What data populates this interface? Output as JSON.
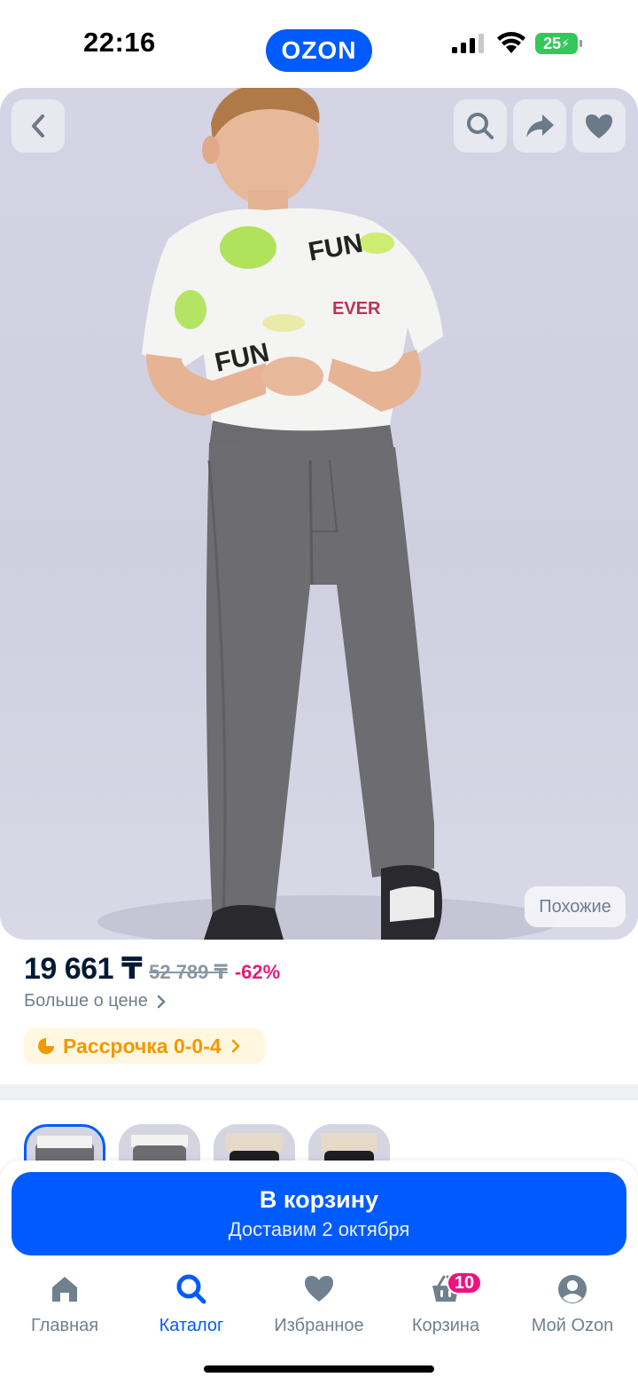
{
  "status_bar": {
    "time": "22:16",
    "logo": "OZON",
    "battery": "25"
  },
  "product": {
    "similar_label": "Похожие",
    "price": "19 661 ₸",
    "old_price": "52 789 ₸",
    "discount": "-62%",
    "more_price_label": "Больше о цене",
    "installment_label": "Рассрочка 0-0-4"
  },
  "cart_button": {
    "title": "В корзину",
    "subtitle": "Доставим 2 октября"
  },
  "tab_bar": {
    "items": [
      {
        "label": "Главная",
        "icon": "home-icon"
      },
      {
        "label": "Каталог",
        "icon": "search-icon"
      },
      {
        "label": "Избранное",
        "icon": "heart-icon"
      },
      {
        "label": "Корзина",
        "icon": "basket-icon",
        "badge": "10"
      },
      {
        "label": "Мой Ozon",
        "icon": "profile-icon"
      }
    ],
    "active": "Каталог"
  },
  "colors": {
    "brand": "#005bff",
    "discount": "#e21d78",
    "installment": "#f29900",
    "badge": "#f1117e"
  }
}
